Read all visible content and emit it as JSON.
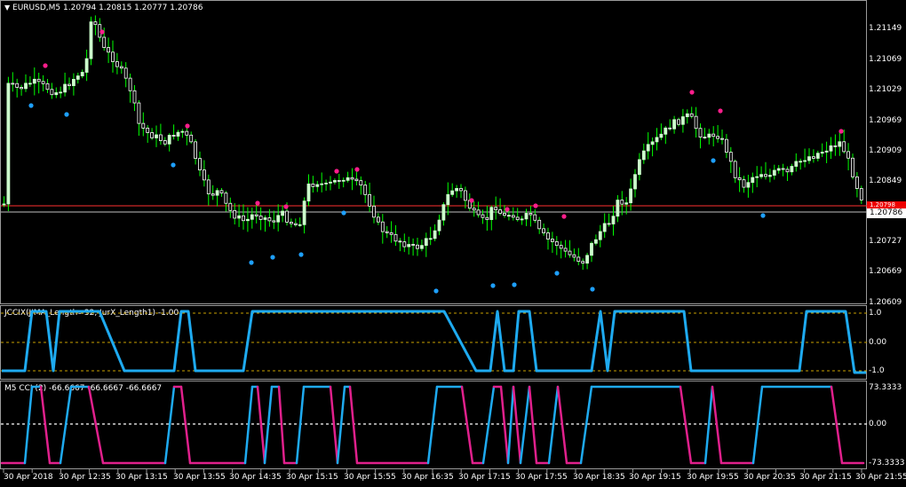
{
  "main": {
    "symbol_title": "EURUSD,M5  1.20794 1.20815 1.20777 1.20786",
    "price_ticks": [
      "1.21149",
      "1.21069",
      "1.21029",
      "1.20969",
      "1.20909",
      "1.20849",
      "1.20727",
      "1.20669",
      "1.20609"
    ],
    "current_price": "1.20786",
    "red_line_price": "1.20798",
    "colors": {
      "bull": "#ccffcc",
      "bear": "#ffffff",
      "wick": "#00ff00",
      "upper_dot": "#ff1e8c",
      "lower_dot": "#1ea0ff",
      "red_line": "#ff3030",
      "grey_line": "#bfbfbf"
    }
  },
  "indicator1": {
    "title": "JCCIX(JJMA_Length=32, JurX_Length1) -1.00",
    "axis_labels": [
      "1.0",
      "0.00",
      "-1.0"
    ],
    "color": "#1eaaf0"
  },
  "indicator2": {
    "title": "M5 CCI (2) -66.6667 -66.6667 -66.6667",
    "axis_labels": [
      "73.3333",
      "0.00",
      "-73.3333"
    ],
    "colors": {
      "up": "#1eaaf0",
      "down": "#e0208c"
    }
  },
  "time_axis": [
    "30 Apr 2018",
    "30 Apr 12:35",
    "30 Apr 13:15",
    "30 Apr 13:55",
    "30 Apr 14:35",
    "30 Apr 15:15",
    "30 Apr 15:55",
    "30 Apr 16:35",
    "30 Apr 17:15",
    "30 Apr 17:55",
    "30 Apr 18:35",
    "30 Apr 19:15",
    "30 Apr 19:55",
    "30 Apr 20:35",
    "30 Apr 21:15",
    "30 Apr 21:55"
  ]
}
